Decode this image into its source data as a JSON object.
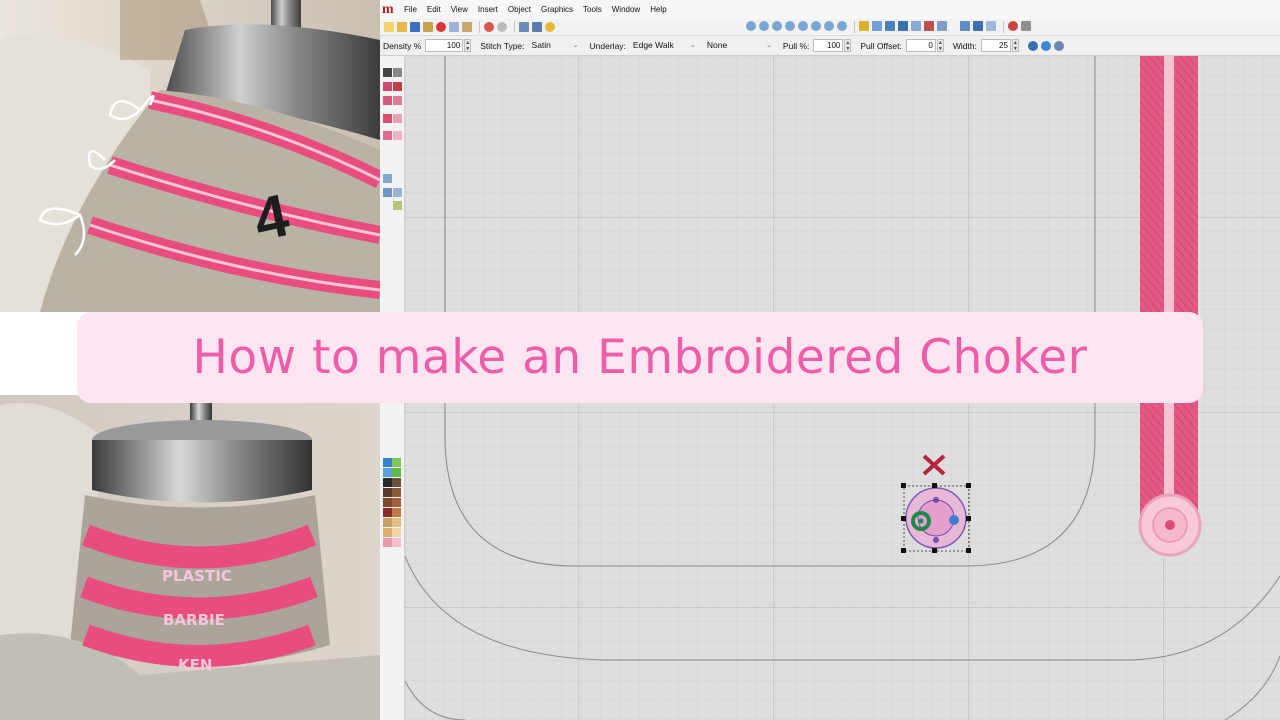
{
  "menu": [
    "File",
    "Edit",
    "View",
    "Insert",
    "Object",
    "Graphics",
    "Tools",
    "Window",
    "Help"
  ],
  "app_logo": "m",
  "properties": {
    "density_label": "Density %",
    "density_value": "100",
    "stitch_type_label": "Stitch Type:",
    "stitch_type_value": "Satin",
    "underlay_label": "Underlay:",
    "underlay_value": "Edge Walk",
    "underlay2_value": "None",
    "pull_label": "Pull %:",
    "pull_value": "100",
    "pull_offset_label": "Pull Offset:",
    "pull_offset_value": "0",
    "width_label": "Width:",
    "width_value": "25"
  },
  "photo_labels": [
    "PLASTIC",
    "BARBIE",
    "KEN"
  ],
  "photo_number": "4",
  "title": "How to make an Embroidered Choker",
  "colors": {
    "embroidery_pink": "#e84d7d",
    "light_pink": "#f7c6d8",
    "banner_bg": "#fde6f1",
    "banner_text": "#ef5da8",
    "canvas_bg": "#dedede"
  },
  "icons": [
    "new-icon",
    "open-icon",
    "save-icon",
    "cut-icon",
    "copy-icon",
    "paste-icon",
    "undo-icon",
    "redo-icon",
    "zoom-in-icon",
    "zoom-out-icon",
    "help-icon"
  ]
}
